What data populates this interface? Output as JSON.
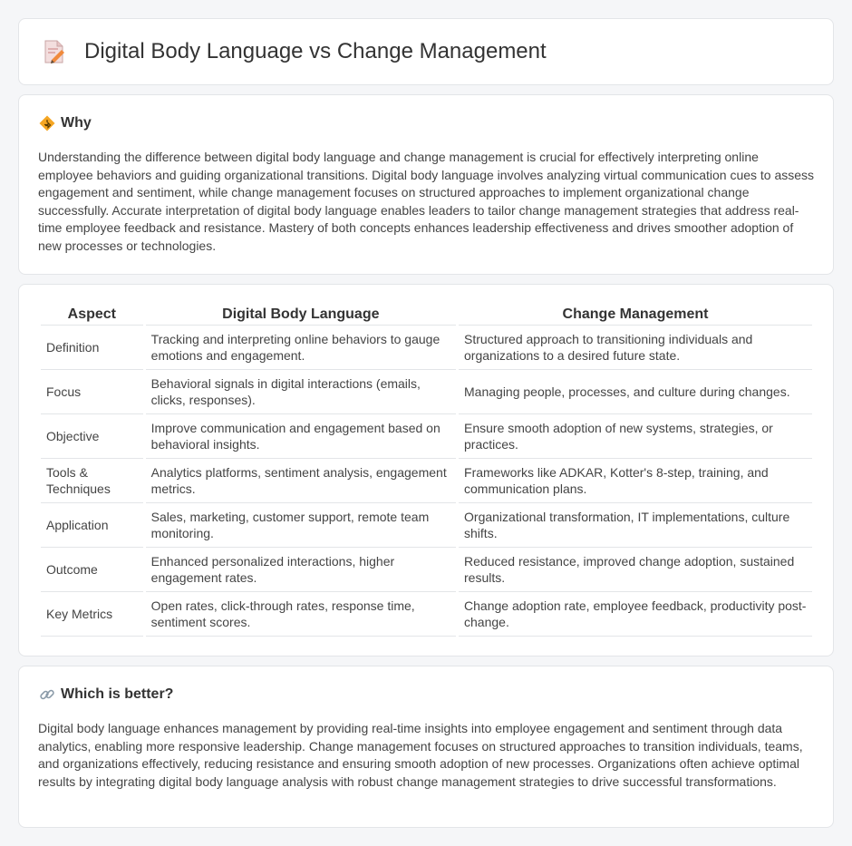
{
  "header": {
    "title": "Digital Body Language vs Change Management",
    "icon": "document-pen-icon"
  },
  "why": {
    "heading": "Why",
    "icon": "road-sign-icon",
    "text": "Understanding the difference between digital body language and change management is crucial for effectively interpreting online employee behaviors and guiding organizational transitions. Digital body language involves analyzing virtual communication cues to assess engagement and sentiment, while change management focuses on structured approaches to implement organizational change successfully. Accurate interpretation of digital body language enables leaders to tailor change management strategies that address real-time employee feedback and resistance. Mastery of both concepts enhances leadership effectiveness and drives smoother adoption of new processes or technologies."
  },
  "comparison": {
    "headers": [
      "Aspect",
      "Digital Body Language",
      "Change Management"
    ],
    "rows": [
      [
        "Definition",
        "Tracking and interpreting online behaviors to gauge emotions and engagement.",
        "Structured approach to transitioning individuals and organizations to a desired future state."
      ],
      [
        "Focus",
        "Behavioral signals in digital interactions (emails, clicks, responses).",
        "Managing people, processes, and culture during changes."
      ],
      [
        "Objective",
        "Improve communication and engagement based on behavioral insights.",
        "Ensure smooth adoption of new systems, strategies, or practices."
      ],
      [
        "Tools & Techniques",
        "Analytics platforms, sentiment analysis, engagement metrics.",
        "Frameworks like ADKAR, Kotter's 8-step, training, and communication plans."
      ],
      [
        "Application",
        "Sales, marketing, customer support, remote team monitoring.",
        "Organizational transformation, IT implementations, culture shifts."
      ],
      [
        "Outcome",
        "Enhanced personalized interactions, higher engagement rates.",
        "Reduced resistance, improved change adoption, sustained results."
      ],
      [
        "Key Metrics",
        "Open rates, click-through rates, response time, sentiment scores.",
        "Change adoption rate, employee feedback, productivity post-change."
      ]
    ]
  },
  "better": {
    "heading": "Which is better?",
    "icon": "link-icon",
    "text": "Digital body language enhances management by providing real-time insights into employee engagement and sentiment through data analytics, enabling more responsive leadership. Change management focuses on structured approaches to transition individuals, teams, and organizations effectively, reducing resistance and ensuring smooth adoption of new processes. Organizations often achieve optimal results by integrating digital body language analysis with robust change management strategies to drive successful transformations."
  }
}
